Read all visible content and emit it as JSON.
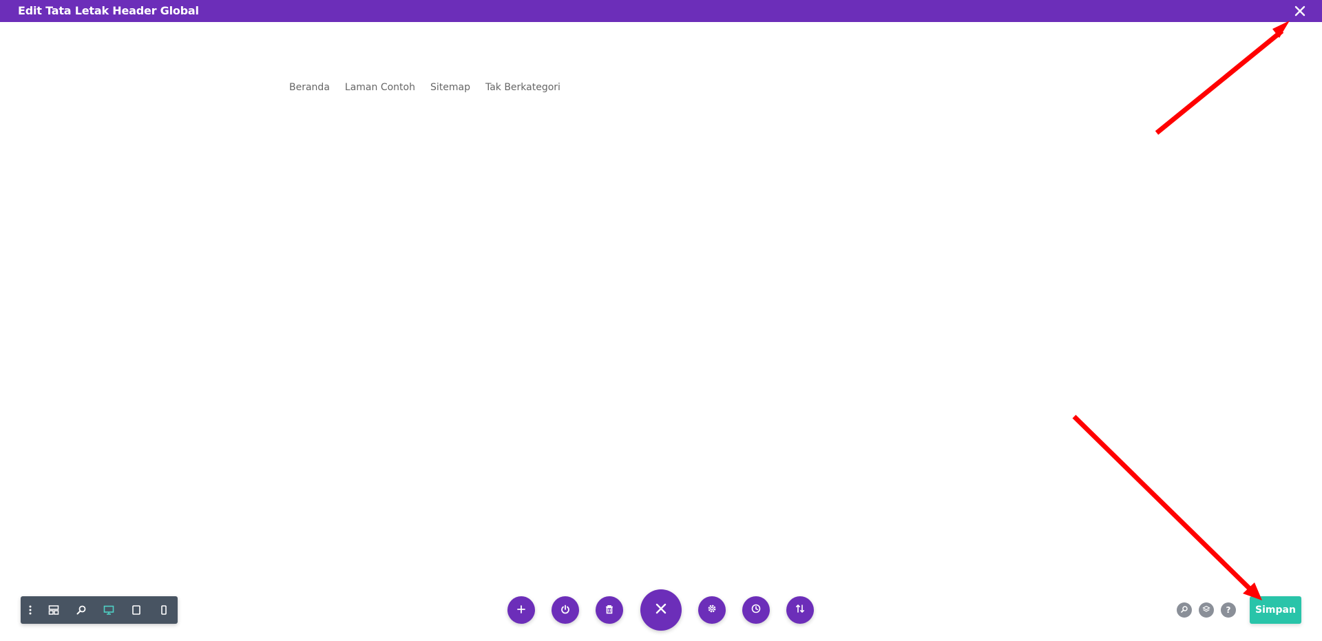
{
  "header": {
    "title": "Edit Tata Letak Header Global",
    "close_icon": "close-icon",
    "background": "#6c2eb9"
  },
  "menu": {
    "items": [
      {
        "label": "Beranda"
      },
      {
        "label": "Laman Contoh"
      },
      {
        "label": "Sitemap"
      },
      {
        "label": "Tak Berkategori"
      }
    ]
  },
  "view_toolbar": {
    "items": [
      {
        "icon": "more-vertical-icon"
      },
      {
        "icon": "wireframe-icon"
      },
      {
        "icon": "zoom-icon"
      },
      {
        "icon": "desktop-icon",
        "active": true
      },
      {
        "icon": "tablet-icon"
      },
      {
        "icon": "phone-icon"
      }
    ]
  },
  "actions": {
    "items": [
      {
        "icon": "plus-icon"
      },
      {
        "icon": "power-icon"
      },
      {
        "icon": "trash-icon"
      },
      {
        "icon": "close-icon"
      },
      {
        "icon": "gear-icon"
      },
      {
        "icon": "history-icon"
      },
      {
        "icon": "sort-icon"
      }
    ]
  },
  "right_tools": {
    "items": [
      {
        "icon": "search-icon"
      },
      {
        "icon": "layers-icon"
      },
      {
        "icon": "help-icon",
        "label": "?"
      }
    ]
  },
  "save": {
    "label": "Simpan",
    "color": "#29c4a9"
  },
  "annotation_color": "#ff0000"
}
